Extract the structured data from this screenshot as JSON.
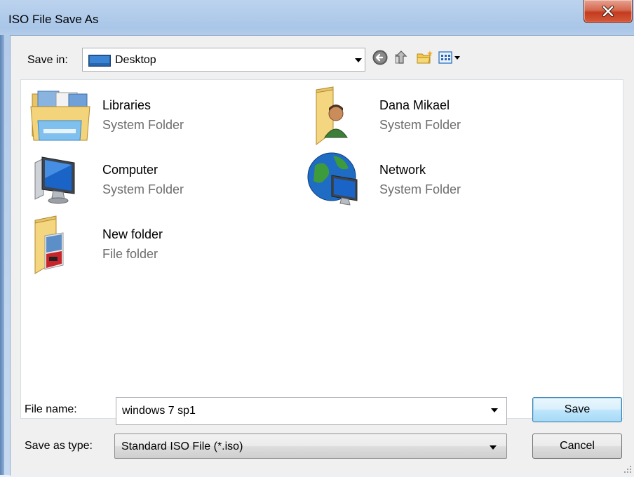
{
  "window": {
    "title": "ISO File Save As"
  },
  "save_in": {
    "label": "Save in:",
    "value": "Desktop"
  },
  "toolbar": {
    "icons": [
      "back-icon",
      "up-folder-icon",
      "new-folder-icon",
      "views-menu-icon"
    ]
  },
  "items": [
    {
      "name": "Libraries",
      "type": "System Folder",
      "icon": "libraries-icon"
    },
    {
      "name": "Dana Mikael",
      "type": "System Folder",
      "icon": "user-folder-icon"
    },
    {
      "name": "Computer",
      "type": "System Folder",
      "icon": "computer-icon"
    },
    {
      "name": "Network",
      "type": "System Folder",
      "icon": "network-icon"
    },
    {
      "name": "New folder",
      "type": "File folder",
      "icon": "folder-icon"
    }
  ],
  "file_name": {
    "label": "File name:",
    "value": "windows 7 sp1"
  },
  "save_as_type": {
    "label": "Save as type:",
    "value": "Standard ISO File (*.iso)"
  },
  "buttons": {
    "save": "Save",
    "cancel": "Cancel"
  },
  "colors": {
    "title_bar": "#b3cce9",
    "close_button": "#c43b1e",
    "default_button_border": "#3c7fb1"
  }
}
